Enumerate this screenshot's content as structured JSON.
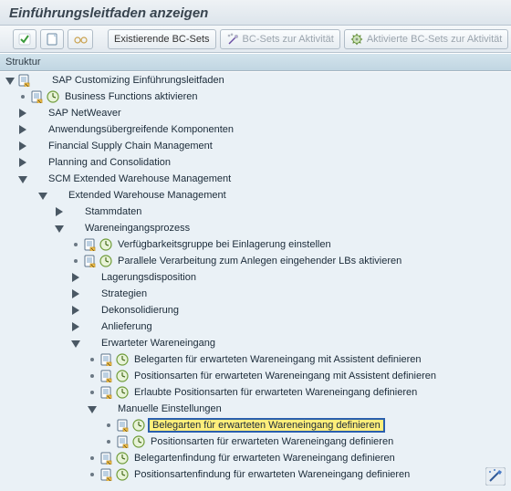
{
  "title": "Einführungsleitfaden anzeigen",
  "toolbar": {
    "existing": "Existierende BC-Sets",
    "to_activity": "BC-Sets zur Aktivität",
    "activated_to_activity": "Aktivierte BC-Sets zur Aktivität"
  },
  "panel_header": "Struktur",
  "tree": {
    "root": "SAP Customizing Einführungsleitfaden",
    "items": {
      "biz_func": "Business Functions aktivieren",
      "netweaver": "SAP NetWeaver",
      "cross_app": "Anwendungsübergreifende Komponenten",
      "fscm": "Financial Supply Chain Management",
      "plc": "Planning and Consolidation",
      "scm_ewm": "SCM Extended Warehouse Management",
      "ewm": "Extended Warehouse Management",
      "stammdaten": "Stammdaten",
      "wep": "Wareneingangsprozess",
      "verfueg": "Verfügbarkeitsgruppe bei Einlagerung einstellen",
      "parallel": "Parallele Verarbeitung zum Anlegen eingehender LBs aktivieren",
      "lagerdisp": "Lagerungsdisposition",
      "strategien": "Strategien",
      "dekon": "Dekonsolidierung",
      "anlief": "Anlieferung",
      "erw_we": "Erwarteter Wareneingang",
      "beleg_assist": "Belegarten für erwarteten Wareneingang mit Assistent definieren",
      "pos_assist": "Positionsarten für erwarteten Wareneingang mit Assistent definieren",
      "erl_pos": "Erlaubte Positionsarten für erwarteten Wareneingang definieren",
      "man_einst": "Manuelle Einstellungen",
      "beleg_def": "Belegarten für erwarteten Wareneingang definieren",
      "pos_def": "Positionsarten für erwarteten Wareneingang definieren",
      "belegfind": "Belegartenfindung für erwarteten Wareneingang definieren",
      "posfind": "Positionsartenfindung für erwarteten Wareneingang definieren"
    }
  }
}
